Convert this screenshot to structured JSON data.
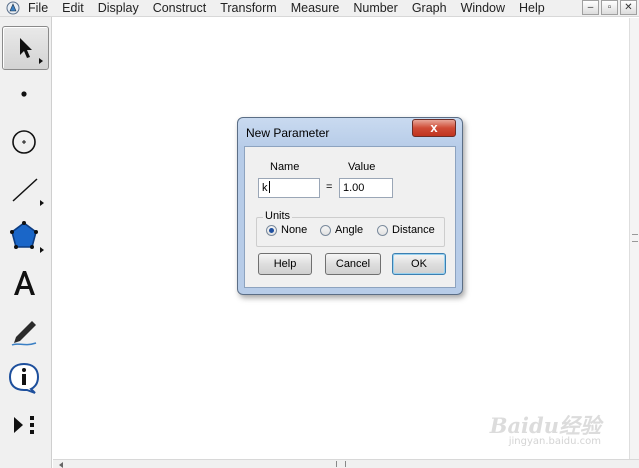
{
  "menu": {
    "items": [
      "File",
      "Edit",
      "Display",
      "Construct",
      "Transform",
      "Measure",
      "Number",
      "Graph",
      "Window",
      "Help"
    ],
    "window_controls": [
      "–",
      "▫",
      "✕"
    ]
  },
  "toolbox": {
    "tools": [
      {
        "name": "arrow",
        "selected": true
      },
      {
        "name": "point"
      },
      {
        "name": "compass"
      },
      {
        "name": "straightedge"
      },
      {
        "name": "polygon"
      },
      {
        "name": "text"
      },
      {
        "name": "marker"
      },
      {
        "name": "information"
      },
      {
        "name": "custom-tool"
      }
    ]
  },
  "dialog": {
    "title": "New Parameter",
    "close_label": "x",
    "name_label": "Name",
    "value_label": "Value",
    "name_value": "k",
    "equals": "=",
    "value_value": "1.00",
    "units_label": "Units",
    "units_options": [
      "None",
      "Angle",
      "Distance"
    ],
    "units_selected": "None",
    "buttons": {
      "help": "Help",
      "cancel": "Cancel",
      "ok": "OK"
    }
  },
  "watermark": {
    "text": "Baidu经验",
    "url": "jingyan.baidu.com"
  }
}
